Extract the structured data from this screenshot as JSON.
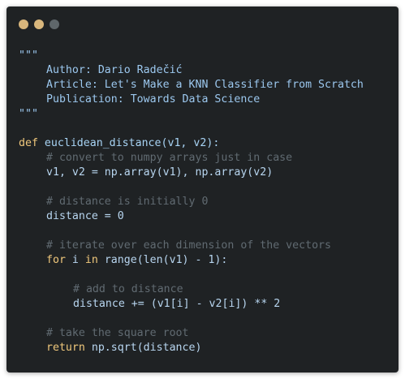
{
  "window": {
    "controls": [
      "close",
      "minimize",
      "maximize"
    ],
    "colors": {
      "background": "#1f2224",
      "dot_close": "#d8b67c",
      "dot_minimize": "#d8b67c",
      "dot_maximize": "#5f676b",
      "text": "#b8d6f0",
      "keyword": "#f0c87c",
      "comment": "#616b72"
    }
  },
  "code": {
    "doc_open": "\"\"\"",
    "author": "Author: Dario Radečić",
    "article": "Article: Let's Make a KNN Classifier from Scratch",
    "publication": "Publication: Towards Data Science",
    "doc_close": "\"\"\"",
    "def_kw": "def",
    "def_sig": " euclidean_distance(v1, v2):",
    "comment_convert": "# convert to numpy arrays just in case",
    "line_arrays": "v1, v2 = np.array(v1), np.array(v2)",
    "comment_init": "# distance is initially 0",
    "line_distance_zero": "distance = 0",
    "comment_iterate": "# iterate over each dimension of the vectors",
    "for_kw": "for",
    "for_rest": " i ",
    "in_kw": "in",
    "for_tail": " range(len(v1) - 1):",
    "comment_add": "# add to distance",
    "line_add": "distance += (v1[i] - v2[i]) ** 2",
    "comment_sqrt": "# take the square root",
    "return_kw": "return",
    "return_rest": " np.sqrt(distance)"
  }
}
